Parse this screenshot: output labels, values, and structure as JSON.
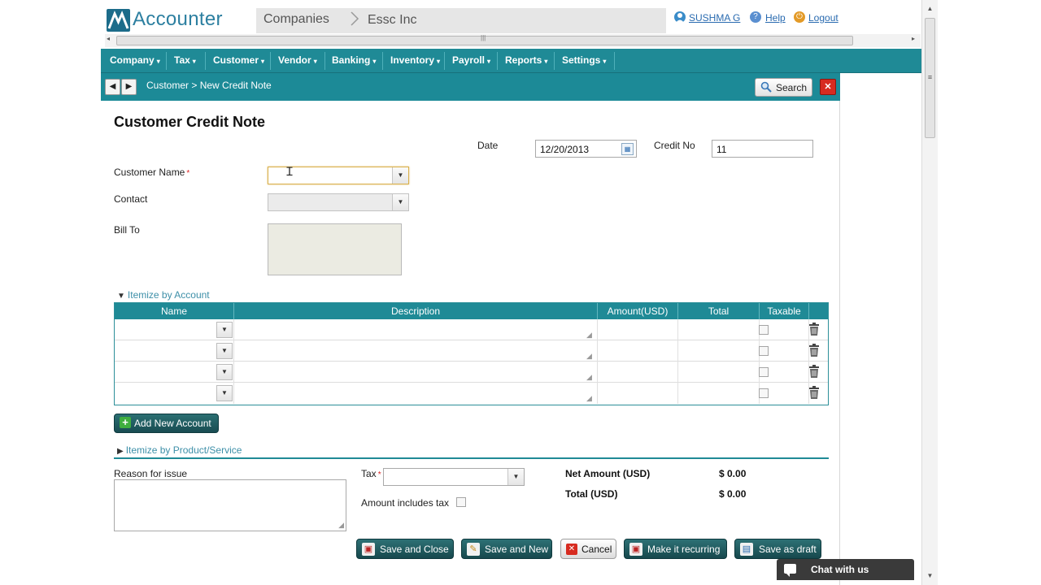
{
  "app": {
    "name": "Accounter"
  },
  "breadcrumb": {
    "root": "Companies",
    "separator": ">",
    "company": "Essc Inc"
  },
  "header_links": {
    "user": "SUSHMA G",
    "help": "Help",
    "logout": "Logout"
  },
  "menu": [
    {
      "label": "Company",
      "caret": "▾"
    },
    {
      "label": "Tax",
      "caret": "▾"
    },
    {
      "label": "Customer",
      "caret": "▾"
    },
    {
      "label": "Vendor",
      "caret": "▾"
    },
    {
      "label": "Banking",
      "caret": "▾"
    },
    {
      "label": "Inventory",
      "caret": "▾"
    },
    {
      "label": "Payroll",
      "caret": "▾"
    },
    {
      "label": "Reports",
      "caret": "▾"
    },
    {
      "label": "Settings",
      "caret": "▾"
    }
  ],
  "subbar": {
    "path": "Customer > New Credit Note",
    "search_label": "Search",
    "close_symbol": "✕"
  },
  "form": {
    "title": "Customer Credit Note",
    "date_label": "Date",
    "date_value": "12/20/2013",
    "credit_no_label": "Credit No",
    "credit_no_value": "11",
    "customer_name_label": "Customer Name",
    "required_mark": "*",
    "contact_label": "Contact",
    "bill_to_label": "Bill To"
  },
  "itemize_account": {
    "toggle_label": "Itemize by Account",
    "columns": [
      "Name",
      "Description",
      "Amount(USD)",
      "Total",
      "Taxable"
    ],
    "row_count": 4,
    "add_button_label": "Add New Account"
  },
  "itemize_product": {
    "toggle_label": "Itemize by Product/Service"
  },
  "footer": {
    "reason_label": "Reason for issue",
    "tax_label": "Tax",
    "amount_includes_tax_label": "Amount includes tax",
    "net_amount_label": "Net Amount (USD)",
    "net_amount_value": "$ 0.00",
    "total_label": "Total (USD)",
    "total_value": "$ 0.00"
  },
  "actions": {
    "save_close": "Save and Close",
    "save_new": "Save and New",
    "cancel": "Cancel",
    "recurring": "Make it recurring",
    "draft": "Save as draft"
  },
  "chat": {
    "label": "Chat with us"
  },
  "colors": {
    "teal": "#1f8a96",
    "dark_teal_button": "#184c52",
    "brand_blue": "#2c7fa0",
    "link_blue": "#2a6bb0",
    "danger_red": "#d72b20"
  }
}
